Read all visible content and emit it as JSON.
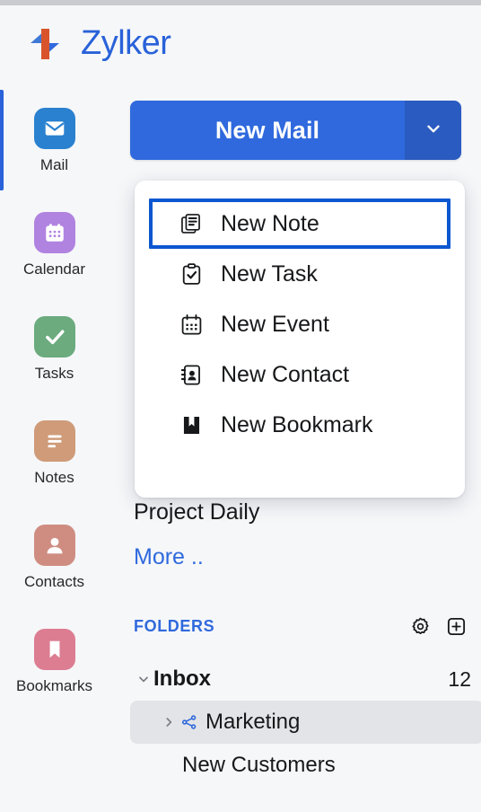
{
  "brand": {
    "name": "Zylker",
    "logo_icon": "zylker-arrow-logo",
    "accent": "#2962d9"
  },
  "rail": {
    "items": [
      {
        "label": "Mail",
        "icon": "envelope-icon",
        "color": "#2a81cf",
        "active": true
      },
      {
        "label": "Calendar",
        "icon": "calendar-icon",
        "color": "#b183e0",
        "active": false
      },
      {
        "label": "Tasks",
        "icon": "check-icon",
        "color": "#6bab7e",
        "active": false
      },
      {
        "label": "Notes",
        "icon": "note-lines-icon",
        "color": "#cf9b79",
        "active": false
      },
      {
        "label": "Contacts",
        "icon": "person-icon",
        "color": "#cf8d82",
        "active": false
      },
      {
        "label": "Bookmarks",
        "icon": "bookmark-icon",
        "color": "#dc7d92",
        "active": false
      }
    ]
  },
  "compose": {
    "label": "New Mail",
    "caret_icon": "chevron-down-icon",
    "color": "#2f69dd",
    "caret_color": "#2a5bc0"
  },
  "menu": {
    "items": [
      {
        "label": "New Note",
        "icon": "note-stack-icon",
        "focused": true
      },
      {
        "label": "New Task",
        "icon": "clipboard-check-icon",
        "focused": false
      },
      {
        "label": "New Event",
        "icon": "calendar-icon",
        "focused": false
      },
      {
        "label": "New Contact",
        "icon": "address-book-icon",
        "focused": false
      },
      {
        "label": "New Bookmark",
        "icon": "bookmark-book-icon",
        "focused": false
      }
    ],
    "focus_ring_color": "#0b57d0"
  },
  "recent": {
    "item_label": "Project Daily",
    "more_label": "More .."
  },
  "folders": {
    "title": "FOLDERS",
    "settings_icon": "gear-icon",
    "add_icon": "plus-box-icon",
    "tree": [
      {
        "label": "Inbox",
        "count": "12",
        "level": 0,
        "expanded": true,
        "selected": false,
        "icon": "",
        "bold": true
      },
      {
        "label": "Marketing",
        "count": "",
        "level": 1,
        "expanded": false,
        "selected": true,
        "icon": "share-icon",
        "bold": false
      },
      {
        "label": "New Customers",
        "count": "",
        "level": 1,
        "expanded": null,
        "selected": false,
        "icon": "",
        "bold": false
      }
    ]
  }
}
